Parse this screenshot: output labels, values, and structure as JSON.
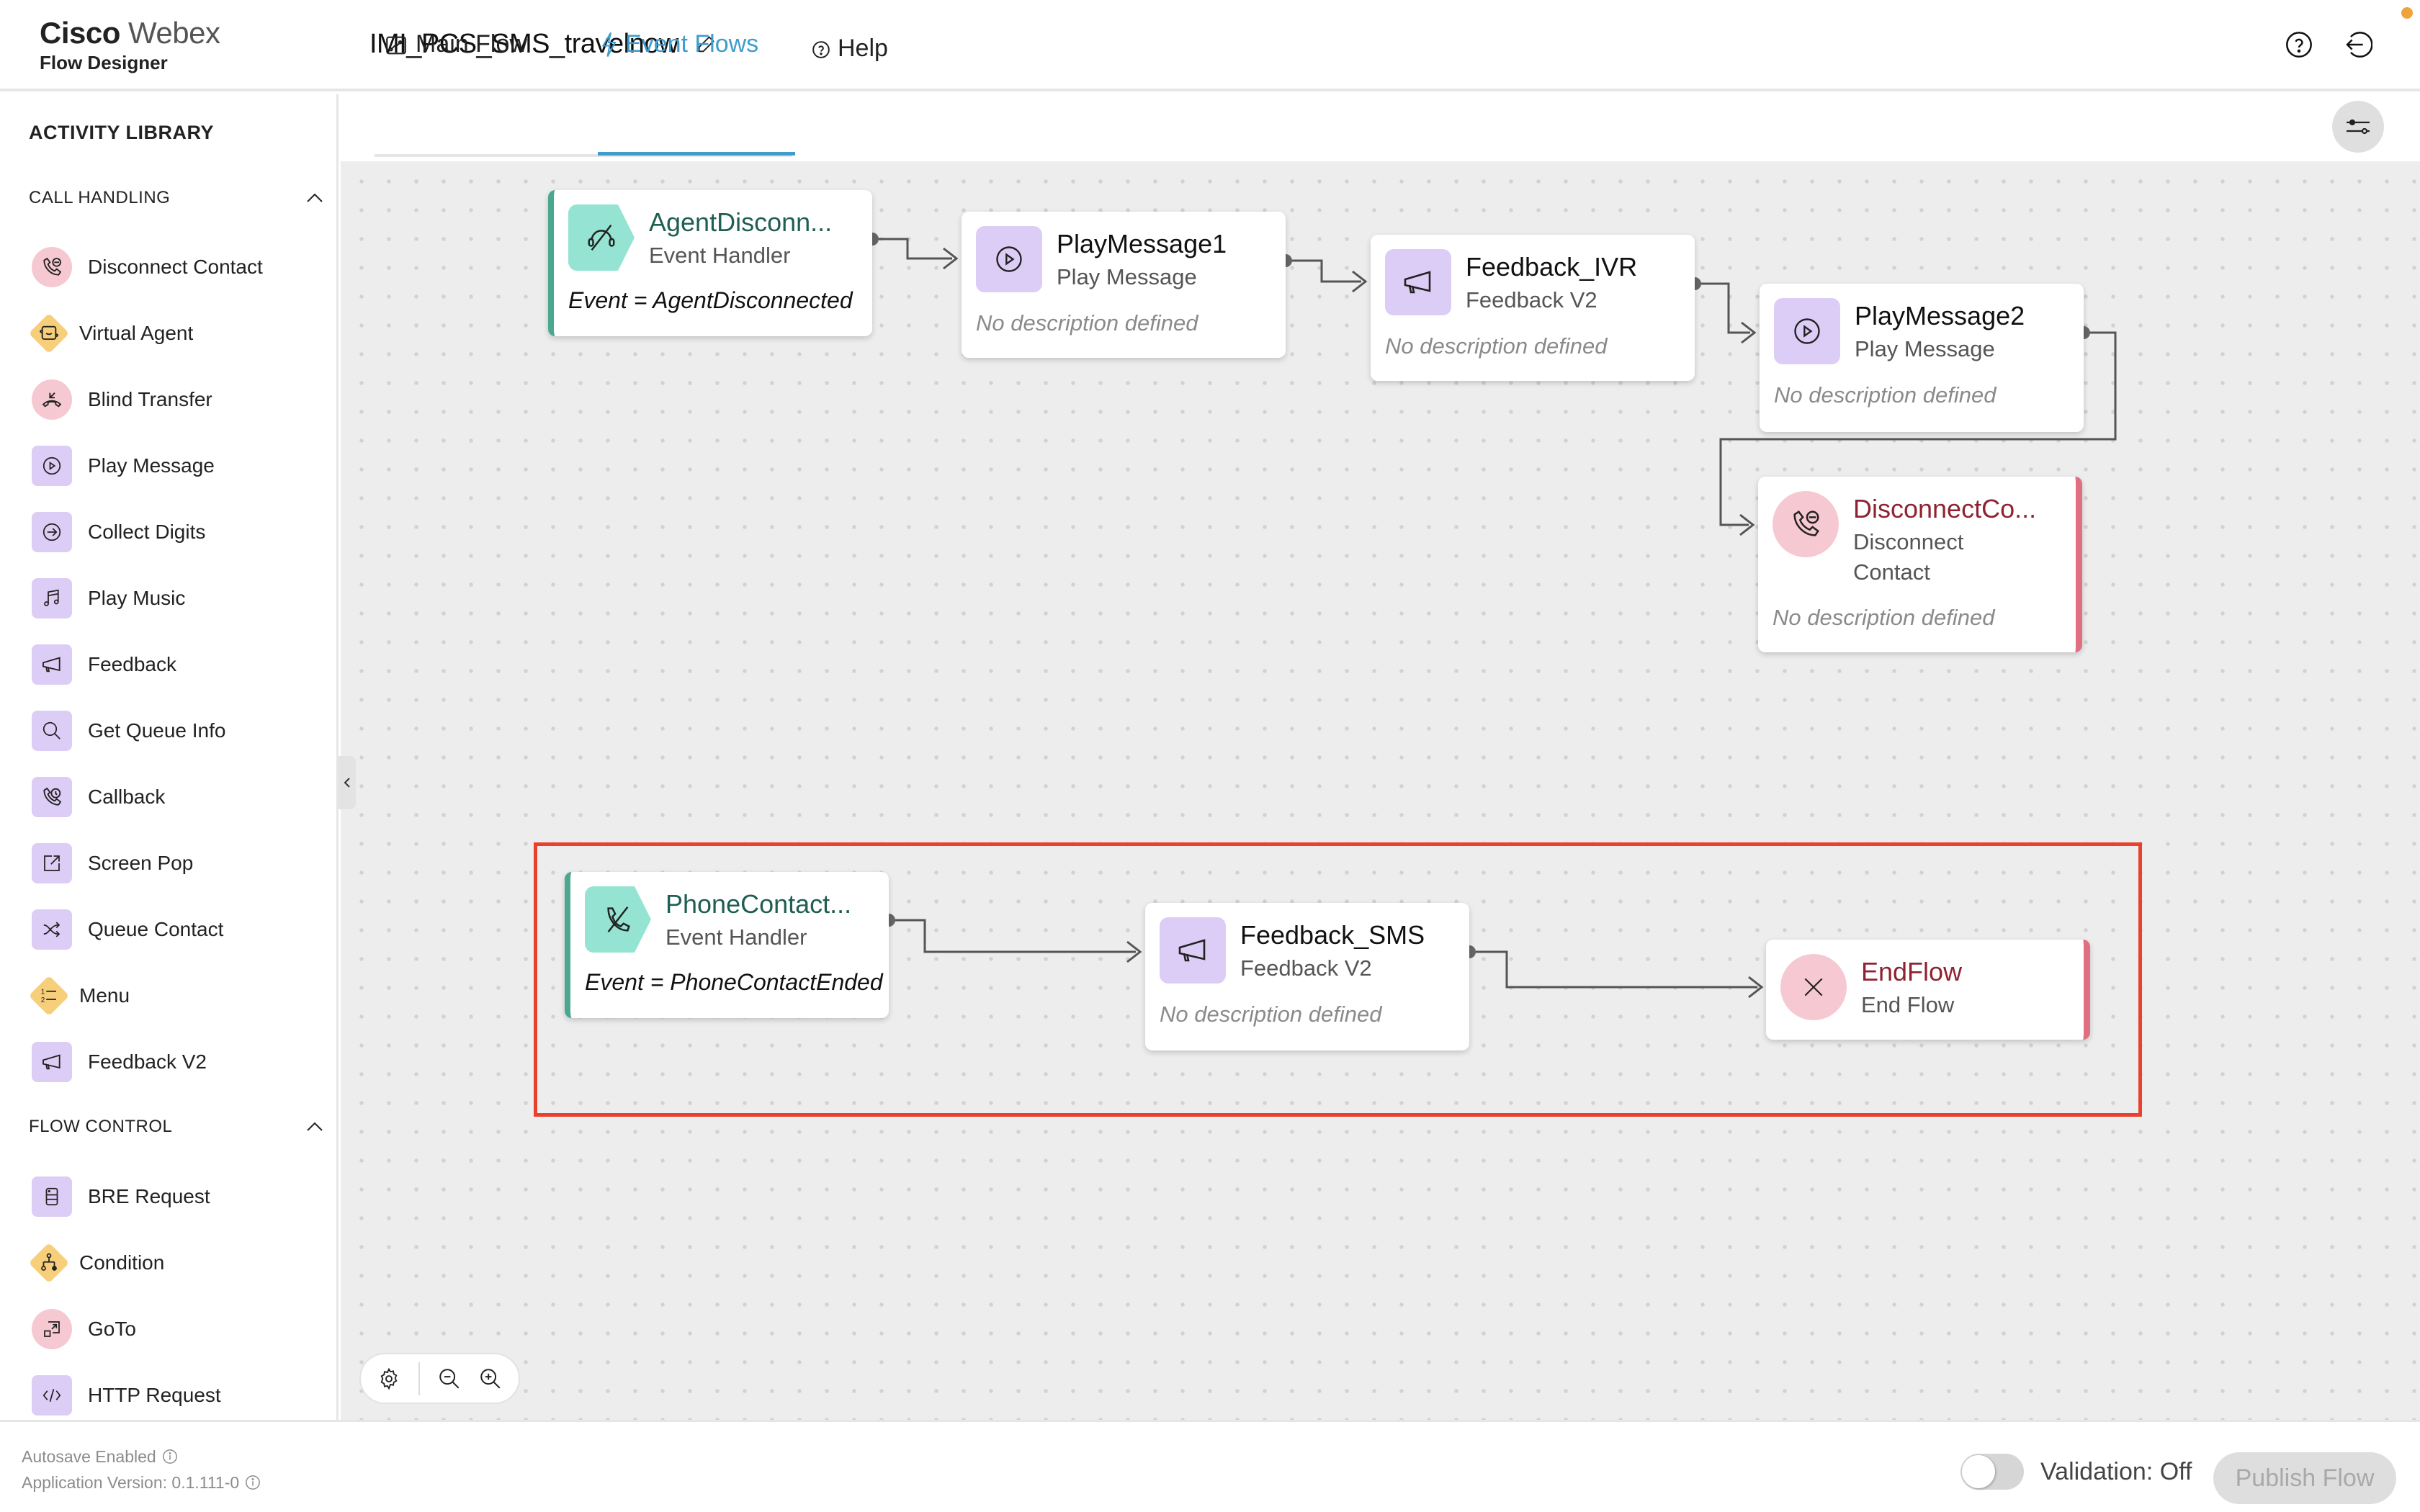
{
  "header": {
    "brand_bold": "Cisco",
    "brand_light": "Webex",
    "product": "Flow Designer",
    "flow_title": "IMI_PCS_SMS_travelnow",
    "icons": [
      "edit-pencil-icon",
      "help-circle-icon",
      "exit-icon"
    ]
  },
  "sidebar": {
    "title": "ACTIVITY LIBRARY",
    "sections": [
      {
        "label": "CALL HANDLING",
        "expanded": true,
        "items": [
          {
            "label": "Disconnect Contact",
            "icon": "disconnect-phone-icon",
            "shape": "circle"
          },
          {
            "label": "Virtual Agent",
            "icon": "virtual-agent-icon",
            "shape": "diamond"
          },
          {
            "label": "Blind Transfer",
            "icon": "blind-transfer-icon",
            "shape": "circle"
          },
          {
            "label": "Play Message",
            "icon": "play-circle-icon",
            "shape": "square"
          },
          {
            "label": "Collect Digits",
            "icon": "arrow-circle-icon",
            "shape": "square"
          },
          {
            "label": "Play Music",
            "icon": "music-note-icon",
            "shape": "square"
          },
          {
            "label": "Feedback",
            "icon": "megaphone-icon",
            "shape": "square"
          },
          {
            "label": "Get Queue Info",
            "icon": "search-icon",
            "shape": "square"
          },
          {
            "label": "Callback",
            "icon": "callback-phone-icon",
            "shape": "square"
          },
          {
            "label": "Screen Pop",
            "icon": "external-link-icon",
            "shape": "square"
          },
          {
            "label": "Queue Contact",
            "icon": "shuffle-icon",
            "shape": "square"
          },
          {
            "label": "Menu",
            "icon": "numbered-list-icon",
            "shape": "diamond"
          },
          {
            "label": "Feedback V2",
            "icon": "megaphone-icon",
            "shape": "square"
          }
        ]
      },
      {
        "label": "FLOW CONTROL",
        "expanded": true,
        "items": [
          {
            "label": "BRE Request",
            "icon": "server-icon",
            "shape": "square"
          },
          {
            "label": "Condition",
            "icon": "branch-icon",
            "shape": "diamond"
          },
          {
            "label": "GoTo",
            "icon": "goto-icon",
            "shape": "circle"
          },
          {
            "label": "HTTP Request",
            "icon": "code-icon",
            "shape": "square"
          }
        ]
      }
    ]
  },
  "tabs": [
    {
      "label": "Main Flow",
      "icon": "flow-icon",
      "active": false
    },
    {
      "label": "Event Flows",
      "icon": "lightning-icon",
      "active": true
    },
    {
      "label": "Help",
      "icon": "help-circle-icon",
      "active": false
    }
  ],
  "canvas": {
    "nodes": [
      {
        "id": "n1",
        "name": "AgentDisconn...",
        "type": "Event Handler",
        "event": "Event = AgentDisconnected",
        "kind": "event"
      },
      {
        "id": "n2",
        "name": "PlayMessage1",
        "type": "Play Message",
        "description": "No description defined",
        "kind": "activity"
      },
      {
        "id": "n3",
        "name": "Feedback_IVR",
        "type": "Feedback V2",
        "description": "No description defined",
        "kind": "activity"
      },
      {
        "id": "n4",
        "name": "PlayMessage2",
        "type": "Play Message",
        "description": "No description defined",
        "kind": "activity"
      },
      {
        "id": "n5",
        "name": "DisconnectCo...",
        "type_line1": "Disconnect",
        "type_line2": "Contact",
        "description": "No description defined",
        "kind": "terminal"
      },
      {
        "id": "n6",
        "name": "PhoneContact...",
        "type": "Event Handler",
        "event": "Event = PhoneContactEnded",
        "kind": "event"
      },
      {
        "id": "n7",
        "name": "Feedback_SMS",
        "type": "Feedback V2",
        "description": "No description defined",
        "kind": "activity"
      },
      {
        "id": "n8",
        "name": "EndFlow",
        "type": "End Flow",
        "kind": "terminal"
      }
    ],
    "edges": [
      [
        "n1",
        "n2"
      ],
      [
        "n2",
        "n3"
      ],
      [
        "n3",
        "n4"
      ],
      [
        "n4",
        "n5"
      ],
      [
        "n6",
        "n7"
      ],
      [
        "n7",
        "n8"
      ]
    ],
    "highlight": {
      "color": "#e8412d",
      "contains": [
        "n6",
        "n7",
        "n8"
      ]
    }
  },
  "footer": {
    "autosave": "Autosave Enabled",
    "version": "Application Version: 0.1.111-0",
    "validation_label": "Validation: Off",
    "validation_on": false,
    "publish_label": "Publish Flow",
    "publish_enabled": false
  },
  "colors": {
    "accent": "#3f9ccc",
    "event_green": "#4aa88f",
    "terminal_red": "#e06f82",
    "activity_purple": "#dccdf6",
    "notification": "#f0a23c"
  }
}
